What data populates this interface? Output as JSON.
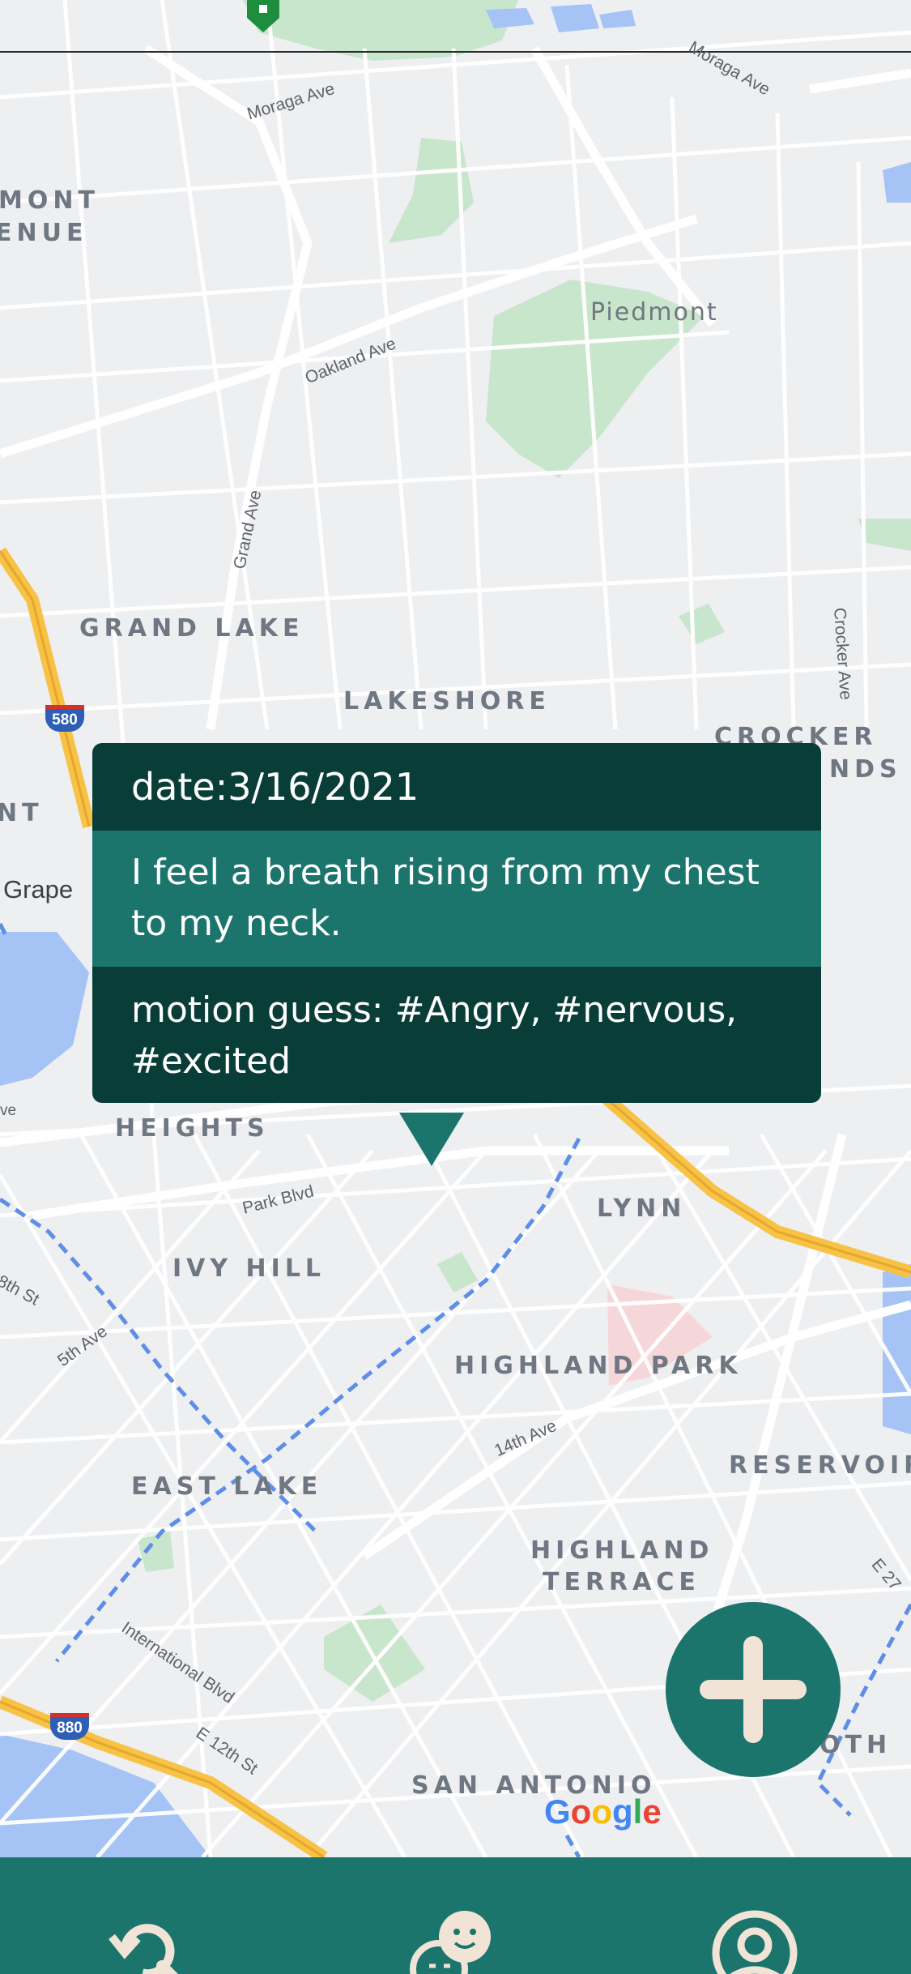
{
  "popup": {
    "date": "date:3/16/2021",
    "note": "I feel a breath rising from my chest to my neck.",
    "emotion": "motion guess: #Angry, #nervous, #excited"
  },
  "map": {
    "neighborhoods": [
      {
        "key": "mont",
        "text": "MONT"
      },
      {
        "key": "enue",
        "text": "ENUE"
      },
      {
        "key": "grand_lake",
        "text": "GRAND LAKE"
      },
      {
        "key": "lakeshore",
        "text": "LAKESHORE"
      },
      {
        "key": "crocker",
        "text": "CROCKER"
      },
      {
        "key": "nds",
        "text": "NDS"
      },
      {
        "key": "nt",
        "text": "NT"
      },
      {
        "key": "heights",
        "text": "HEIGHTS"
      },
      {
        "key": "lynn",
        "text": "LYNN"
      },
      {
        "key": "ivy_hill",
        "text": "IVY HILL"
      },
      {
        "key": "highland_park",
        "text": "HIGHLAND PARK"
      },
      {
        "key": "reservoir",
        "text": "RESERVOIR"
      },
      {
        "key": "east_lake",
        "text": "EAST LAKE"
      },
      {
        "key": "highland",
        "text": "HIGHLAND"
      },
      {
        "key": "terrace",
        "text": "TERRACE"
      },
      {
        "key": "oth",
        "text": "OTH"
      },
      {
        "key": "san_antonio",
        "text": "SAN ANTONIO"
      }
    ],
    "roads": {
      "moraga_ave": "Moraga Ave",
      "moraga_ave_2": "Moraga Ave",
      "oakland_ave": "Oakland Ave",
      "grand_ave": "Grand Ave",
      "crocker_ave": "Crocker Ave",
      "park_blvd": "Park Blvd",
      "fifth_ave": "5th Ave",
      "eighth_st": "8th St",
      "fourteenth_ave": "14th Ave",
      "international_blvd": "International Blvd",
      "e12th_st": "E 12th St",
      "e27": "E 27",
      "grape": "Grape",
      "ve": "ve"
    },
    "places": {
      "piedmont": "Piedmont"
    },
    "shields": {
      "i580": "580",
      "i880": "880"
    },
    "google": [
      "G",
      "o",
      "o",
      "g",
      "l",
      "e"
    ],
    "colors": {
      "land": "#eeeff1",
      "road": "#ffffff",
      "park": "#c8e6cb",
      "water": "#a5c3f5",
      "highway": "#f7c245",
      "transit": "#5e8ee8"
    }
  },
  "fab": {
    "icon": "plus-icon",
    "color": "#1b756c"
  },
  "nav": {
    "color": "#1b756c",
    "items": [
      {
        "name": "search-history",
        "icon": "search-refresh-icon"
      },
      {
        "name": "emotions",
        "icon": "emotion-faces-icon"
      },
      {
        "name": "profile",
        "icon": "user-circle-icon"
      }
    ]
  }
}
